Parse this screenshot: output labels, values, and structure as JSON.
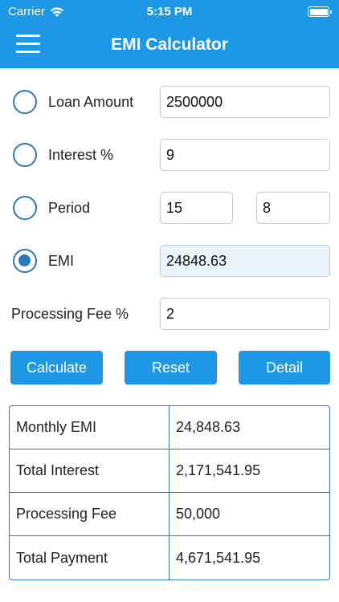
{
  "status": {
    "carrier": "Carrier",
    "time": "5:15 PM"
  },
  "header": {
    "title": "EMI Calculator"
  },
  "form": {
    "loan_amount": {
      "label": "Loan Amount",
      "value": "2500000",
      "selected": false
    },
    "interest": {
      "label": "Interest %",
      "value": "9",
      "selected": false
    },
    "period": {
      "label": "Period",
      "years": "15",
      "months": "8",
      "selected": false
    },
    "emi": {
      "label": "EMI",
      "value": "24848.63",
      "selected": true
    },
    "processing_fee": {
      "label": "Processing Fee %",
      "value": "2"
    }
  },
  "buttons": {
    "calculate": "Calculate",
    "reset": "Reset",
    "detail": "Detail"
  },
  "results": [
    {
      "label": "Monthly EMI",
      "value": "24,848.63"
    },
    {
      "label": "Total Interest",
      "value": "2,171,541.95"
    },
    {
      "label": "Processing Fee",
      "value": "50,000"
    },
    {
      "label": "Total Payment",
      "value": "4,671,541.95"
    }
  ],
  "colors": {
    "accent": "#1e98e6",
    "radio": "#2b7ab8",
    "readonly_bg": "#e9f4fc"
  }
}
